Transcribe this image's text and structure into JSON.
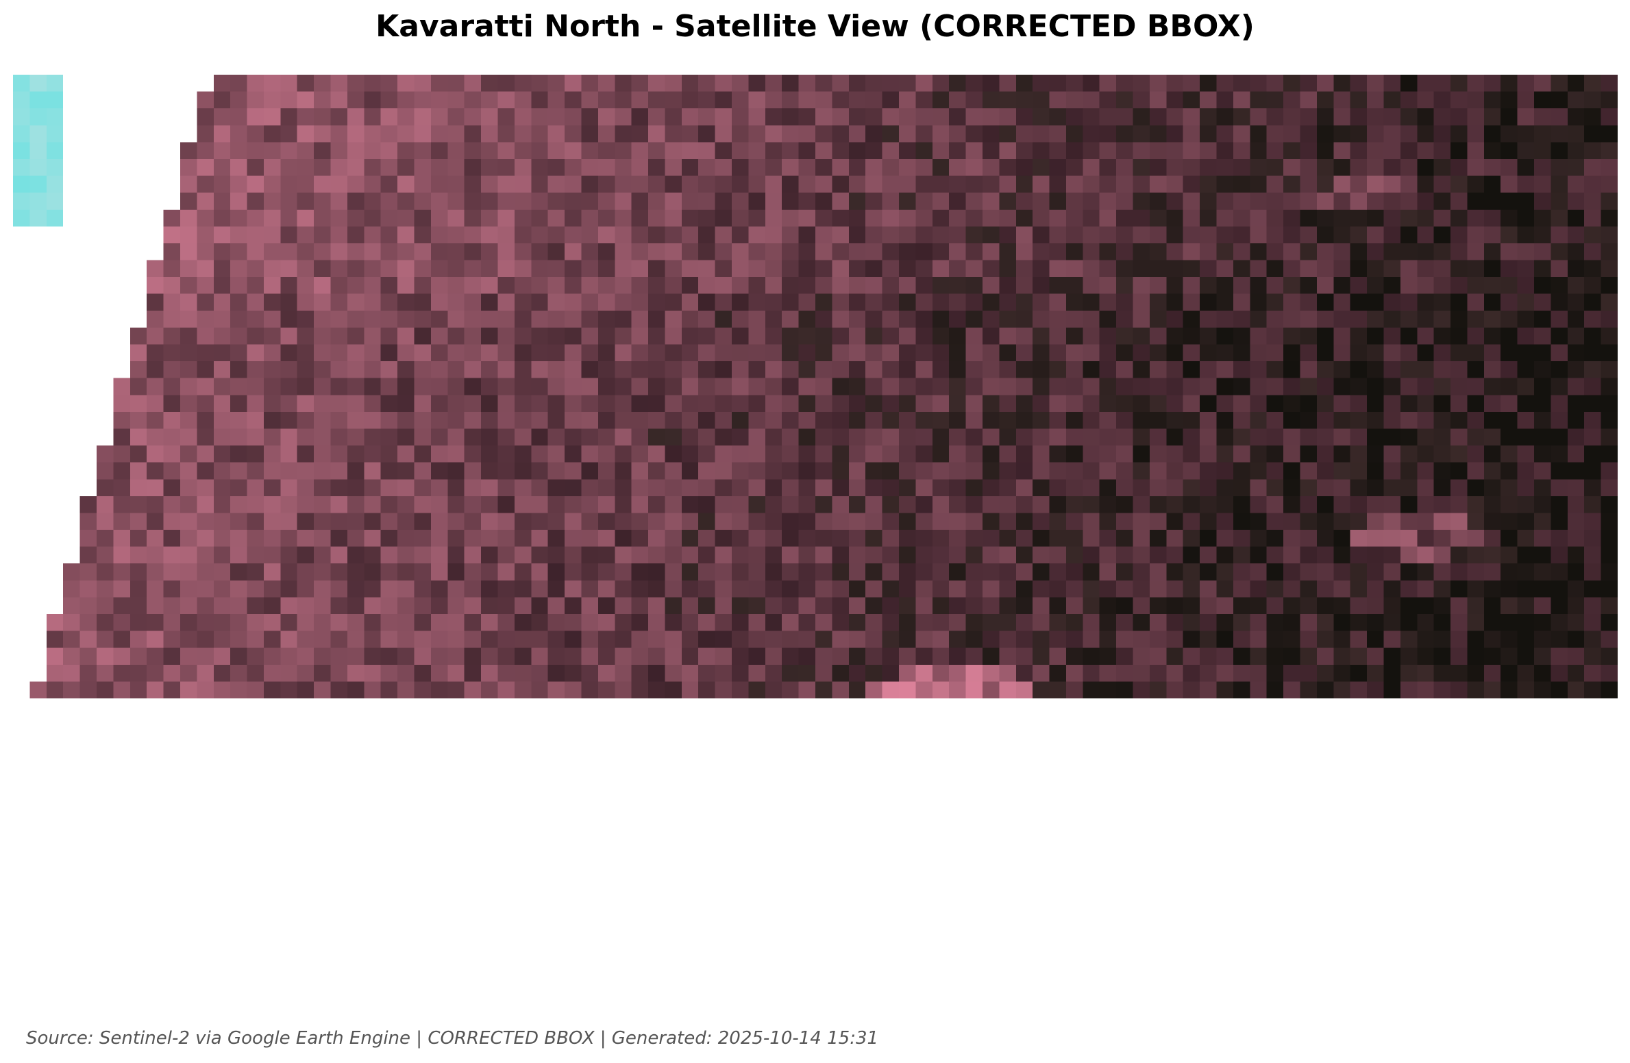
{
  "title": "Kavaratti North - Satellite View (CORRECTED BBOX)",
  "footer": "Source: Sentinel-2 via Google Earth Engine | CORRECTED BBOX | Generated: 2025-10-14 15:31",
  "image": {
    "description_colors": {
      "land_vegetation": "#b07888",
      "dark_canopy": "#1a0d10",
      "water_cyan": "#7fe6e0",
      "sand_white": "#ffffff",
      "bright_pink": "#f0a0a8"
    }
  }
}
